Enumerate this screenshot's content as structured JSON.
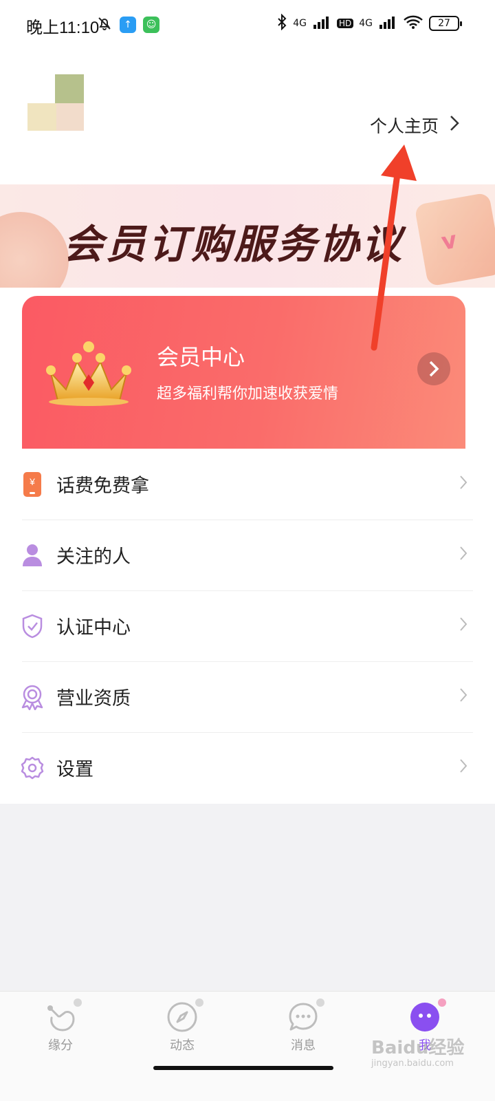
{
  "status_bar": {
    "time": "晚上11:10",
    "network_1": "4G",
    "hd": "HD",
    "network_2": "4G",
    "battery": "27"
  },
  "profile": {
    "homepage_label": "个人主页"
  },
  "banner": {
    "title": "会员订购服务协议"
  },
  "vip": {
    "title": "会员中心",
    "subtitle": "超多福利帮你加速收获爱情"
  },
  "menu": {
    "items": [
      {
        "label": "话费免费拿",
        "icon": "phone-bill-icon"
      },
      {
        "label": "关注的人",
        "icon": "person-icon"
      },
      {
        "label": "认证中心",
        "icon": "shield-check-icon"
      },
      {
        "label": "营业资质",
        "icon": "badge-icon"
      },
      {
        "label": "设置",
        "icon": "gear-icon"
      }
    ]
  },
  "nav": {
    "tabs": [
      {
        "label": "缘分",
        "icon": "hand-icon"
      },
      {
        "label": "动态",
        "icon": "compass-icon"
      },
      {
        "label": "消息",
        "icon": "chat-icon"
      },
      {
        "label": "我",
        "icon": "me-icon"
      }
    ]
  },
  "watermark": {
    "main": "Baidu经验",
    "sub": "jingyan.baidu.com"
  },
  "colors": {
    "vip_start": "#fb5a63",
    "vip_end": "#fb8b79",
    "menu_icon_purple": "#b98de0",
    "active_tab": "#8a4ff0",
    "annotation_arrow": "#f0402a"
  }
}
